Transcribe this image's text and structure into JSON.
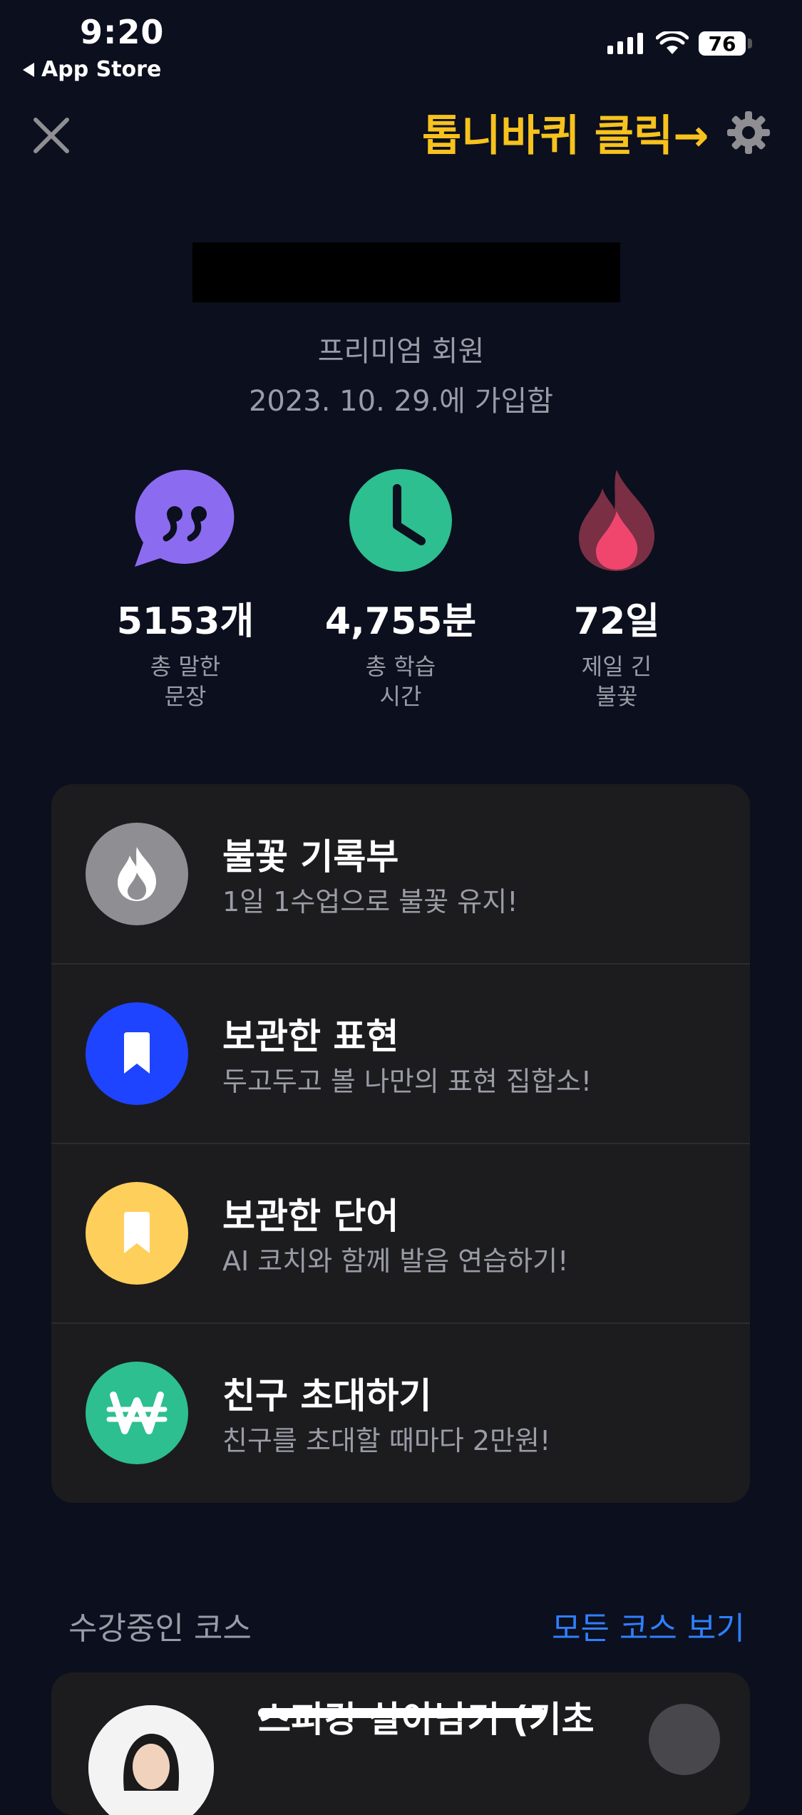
{
  "status": {
    "time": "9:20",
    "back_app": "App Store",
    "battery": "76"
  },
  "annotation": {
    "text": "톱니바퀴 클릭→",
    "color": "#f7c21d"
  },
  "profile": {
    "membership": "프리미엄 회원",
    "joined": "2023. 10. 29.에 가입함"
  },
  "stats": [
    {
      "icon": "quote-bubble-icon",
      "value": "5153개",
      "label_line1": "총 말한",
      "label_line2": "문장",
      "color": "#8b6cf0"
    },
    {
      "icon": "clock-icon",
      "value": "4,755분",
      "label_line1": "총 학습",
      "label_line2": "시간",
      "color": "#2dbf8f"
    },
    {
      "icon": "flame-icon",
      "value": "72일",
      "label_line1": "제일 긴",
      "label_line2": "불꽃",
      "color": "#e8486a"
    }
  ],
  "menu": [
    {
      "icon": "flame-icon",
      "title": "불꽃 기록부",
      "subtitle": "1일 1수업으로 불꽃 유지!",
      "color": "#8e8e93"
    },
    {
      "icon": "bookmark-icon",
      "title": "보관한 표현",
      "subtitle": "두고두고 볼 나만의 표현 집합소!",
      "color": "#1e44ff"
    },
    {
      "icon": "bookmark-icon",
      "title": "보관한 단어",
      "subtitle": "AI 코치와 함께 발음 연습하기!",
      "color": "#ffcf5c"
    },
    {
      "icon": "won-icon",
      "title": "친구 초대하기",
      "subtitle": "친구를 초대할 때마다 2만원!",
      "color": "#2dbf8f"
    }
  ],
  "courses": {
    "section_label": "수강중인 코스",
    "view_all": "모든 코스 보기",
    "first_course_title": "스피킹 살아남기 (기초"
  }
}
